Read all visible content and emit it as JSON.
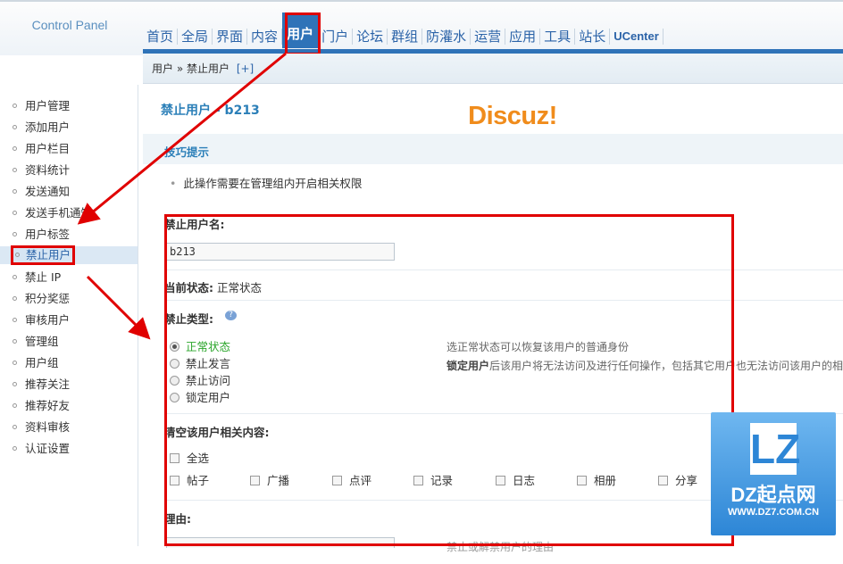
{
  "logo": {
    "main": "Discuz!",
    "sub": "Control Panel"
  },
  "nav": {
    "items": [
      "首页",
      "全局",
      "界面",
      "内容",
      "用户",
      "门户",
      "论坛",
      "群组",
      "防灌水",
      "运营",
      "应用",
      "工具",
      "站长",
      "UCenter"
    ],
    "active_index": 4
  },
  "breadcrumb": {
    "text": "用户 » 禁止用户",
    "plus": "[+]"
  },
  "sidebar": {
    "items": [
      "用户管理",
      "添加用户",
      "用户栏目",
      "资料统计",
      "发送通知",
      "发送手机通知",
      "用户标签",
      "禁止用户",
      "禁止 IP",
      "积分奖惩",
      "审核用户",
      "管理组",
      "用户组",
      "推荐关注",
      "推荐好友",
      "资料审核",
      "认证设置"
    ],
    "active_index": 7
  },
  "main": {
    "title": "禁止用户 - b213",
    "tip_title": "技巧提示",
    "tip_text": "此操作需要在管理组内开启相关权限",
    "username_label": "禁止用户名:",
    "username_value": "b213",
    "status_label": "当前状态:",
    "status_value": "正常状态",
    "ban_type_label": "禁止类型:",
    "ban_types": [
      "正常状态",
      "禁止发言",
      "禁止访问",
      "锁定用户"
    ],
    "ban_type_selected": 0,
    "ban_desc_1": "选正常状态可以恢复该用户的普通身份",
    "ban_desc_2_bold": "锁定用户",
    "ban_desc_2_rest": "后该用户将无法访问及进行任何操作，包括其它用户也无法访问该用户的相",
    "clear_label": "清空该用户相关内容:",
    "clear_all": "全选",
    "clear_items": [
      "帖子",
      "广播",
      "点评",
      "记录",
      "日志",
      "相册",
      "分享"
    ],
    "reason_label": "理由:",
    "reason_desc": "禁止或解禁用户的理由"
  },
  "watermark": {
    "logo": "LZ",
    "name": "DZ起点网",
    "url": "WWW.DZ7.COM.CN"
  },
  "colors": {
    "accent": "#2f73b8",
    "highlight": "#e00000",
    "logo_orange": "#f08c1c"
  }
}
